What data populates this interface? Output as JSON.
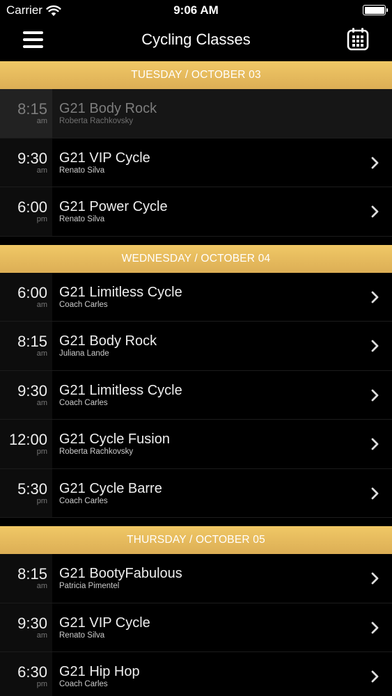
{
  "status_bar": {
    "carrier": "Carrier",
    "time": "9:06 AM"
  },
  "nav": {
    "title": "Cycling Classes",
    "menu_icon": "hamburger-menu-icon",
    "calendar_icon": "calendar-icon"
  },
  "colors": {
    "section_header": "#e3b65c",
    "background": "#000000"
  },
  "sections": [
    {
      "label": "TUESDAY / OCTOBER 03",
      "classes": [
        {
          "time": "8:15",
          "ampm": "am",
          "name": "G21 Body Rock",
          "instructor": "Roberta Rachkovsky",
          "past": true
        },
        {
          "time": "9:30",
          "ampm": "am",
          "name": "G21 VIP Cycle",
          "instructor": "Renato Silva",
          "past": false
        },
        {
          "time": "6:00",
          "ampm": "pm",
          "name": "G21 Power Cycle",
          "instructor": "Renato Silva",
          "past": false
        }
      ]
    },
    {
      "label": "WEDNESDAY / OCTOBER 04",
      "classes": [
        {
          "time": "6:00",
          "ampm": "am",
          "name": "G21 Limitless Cycle",
          "instructor": "Coach Carles",
          "past": false
        },
        {
          "time": "8:15",
          "ampm": "am",
          "name": "G21 Body Rock",
          "instructor": "Juliana Lande",
          "past": false
        },
        {
          "time": "9:30",
          "ampm": "am",
          "name": "G21 Limitless Cycle",
          "instructor": "Coach Carles",
          "past": false
        },
        {
          "time": "12:00",
          "ampm": "pm",
          "name": "G21 Cycle Fusion",
          "instructor": "Roberta Rachkovsky",
          "past": false
        },
        {
          "time": "5:30",
          "ampm": "pm",
          "name": "G21 Cycle Barre",
          "instructor": "Coach Carles",
          "past": false
        }
      ]
    },
    {
      "label": "THURSDAY / OCTOBER 05",
      "classes": [
        {
          "time": "8:15",
          "ampm": "am",
          "name": "G21 BootyFabulous",
          "instructor": "Patricia Pimentel",
          "past": false
        },
        {
          "time": "9:30",
          "ampm": "am",
          "name": "G21 VIP Cycle",
          "instructor": "Renato Silva",
          "past": false
        },
        {
          "time": "6:30",
          "ampm": "pm",
          "name": "G21 Hip Hop",
          "instructor": "Coach Carles",
          "past": false
        }
      ]
    }
  ]
}
